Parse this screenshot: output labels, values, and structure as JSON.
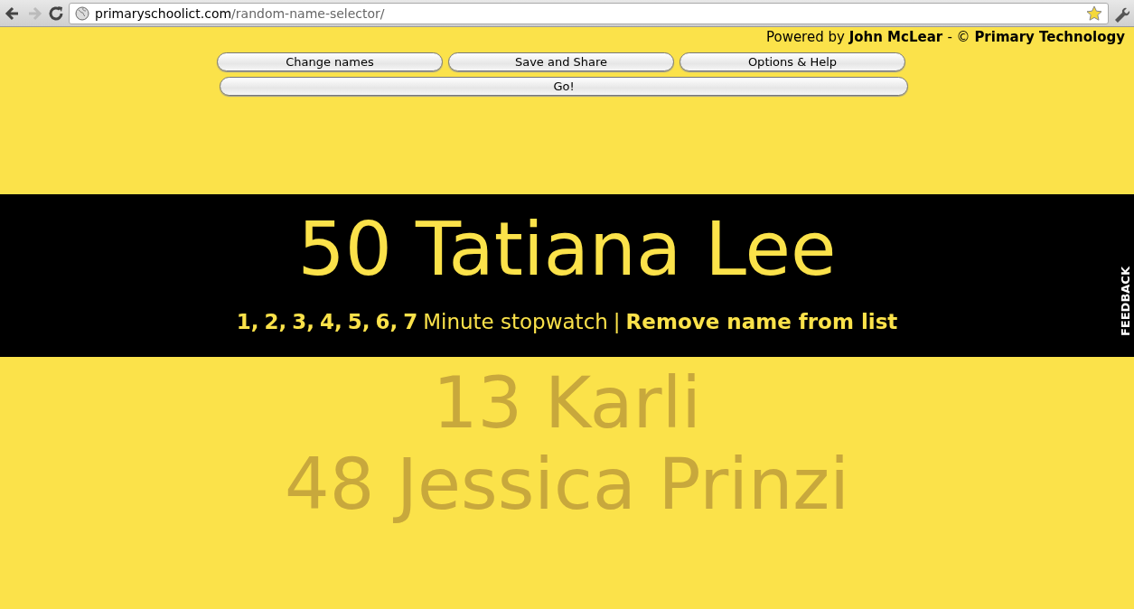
{
  "browser": {
    "back_disabled": false,
    "forward_disabled": true,
    "url_host": "primaryschoolict.com",
    "url_path": "/random-name-selector/",
    "bookmarked": true
  },
  "credit": {
    "prefix": "Powered by",
    "author": "John McLear",
    "separator": "- ©",
    "site": "Primary Technology"
  },
  "buttons": [
    {
      "label": "Change names"
    },
    {
      "label": "Save and Share"
    },
    {
      "label": "Options & Help"
    }
  ],
  "go_button": {
    "label": "Go!"
  },
  "selected_name": "50 Tatiana Lee",
  "stopwatch": {
    "minutes": [
      "1,",
      "2,",
      "3,",
      "4,",
      "5,",
      "6,",
      "7"
    ],
    "label": "Minute stopwatch",
    "divider": "|",
    "remove_link": "Remove name from list"
  },
  "feedback_tab": "FEEDBACK",
  "upcoming_names": [
    "13 Karli",
    "48 Jessica Prinzi"
  ]
}
